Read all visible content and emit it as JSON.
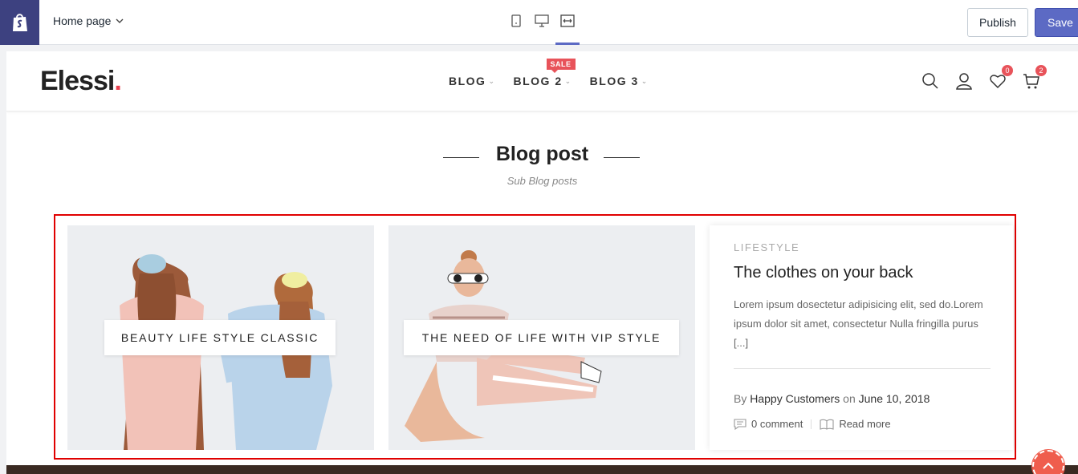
{
  "editor": {
    "page_select": "Home page",
    "publish_label": "Publish",
    "save_label": "Save"
  },
  "header": {
    "brand": "Elessi",
    "nav": [
      {
        "label": "BLOG"
      },
      {
        "label": "BLOG 2",
        "badge": "SALE"
      },
      {
        "label": "BLOG 3"
      }
    ],
    "wishlist_count": "0",
    "cart_count": "2"
  },
  "section": {
    "title": "Blog post",
    "subtitle": "Sub Blog posts"
  },
  "cards": [
    {
      "label": "BEAUTY LIFE STYLE CLASSIC"
    },
    {
      "label": "THE NEED OF LIFE WITH VIP STYLE"
    }
  ],
  "post": {
    "category": "LIFESTYLE",
    "title": "The clothes on your back",
    "excerpt": "Lorem ipsum dosectetur adipisicing elit, sed do.Lorem ipsum dolor sit amet, consectetur Nulla fringilla purus [...]",
    "by_label": "By",
    "author": "Happy Customers",
    "on_label": "on",
    "date": "June 10, 2018",
    "comments": "0 comment",
    "read_more": "Read more"
  },
  "colors": {
    "accent": "#5c6ac4",
    "brand_dot": "#e8404f",
    "badge": "#e8535a",
    "highlight": "#e00000"
  }
}
